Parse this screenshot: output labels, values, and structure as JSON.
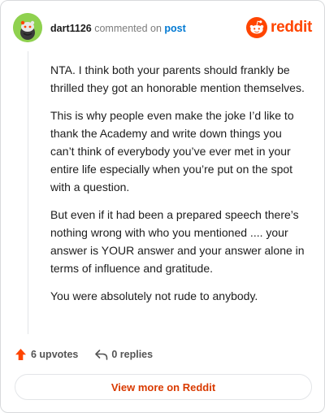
{
  "header": {
    "username": "dart1126",
    "action_text": "commented on",
    "post_link": "post",
    "brand_name": "reddit"
  },
  "comment": {
    "paragraphs": [
      "NTA. I think both your parents should frankly be thrilled they got an honorable mention themselves.",
      "This is why people even make the joke I’d like to thank the Academy and write down things you can’t think of everybody you’ve ever met in your entire life especially when you’re put on the spot with a question.",
      "But even if it had been a prepared speech there’s nothing wrong with who you mentioned .... your answer is YOUR answer and your answer alone in terms of influence and gratitude.",
      "You were absolutely not rude to anybody."
    ]
  },
  "actions": {
    "upvotes_label": "6 upvotes",
    "replies_label": "0 replies"
  },
  "view_more_label": "View more on Reddit",
  "colors": {
    "brand": "#ff4500",
    "link": "#0079d3",
    "avatar_bg": "#8fd14f",
    "cta_text": "#d93a00"
  },
  "icons": {
    "avatar": "snoo-avatar-icon",
    "brand": "reddit-logo-icon",
    "upvote": "upvote-arrow-icon",
    "reply": "reply-arrow-icon"
  }
}
